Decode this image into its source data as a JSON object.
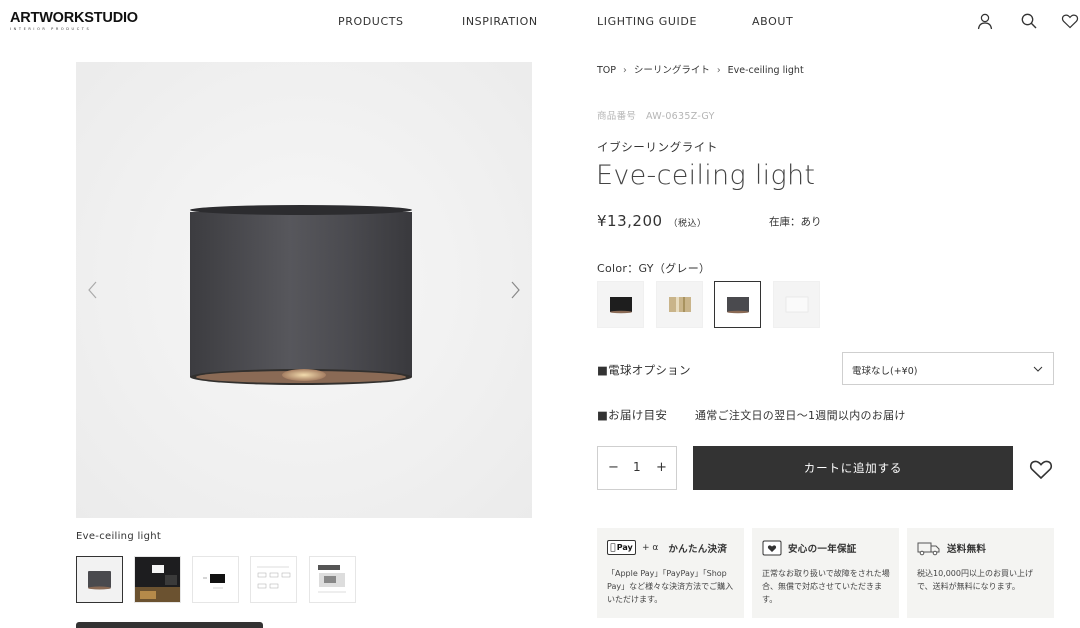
{
  "header": {
    "logo_main": "ARTWORKSTUDIO",
    "logo_sub": "INTERIOR PRODUCTS",
    "nav": [
      "PRODUCTS",
      "INSPIRATION",
      "LIGHTING GUIDE",
      "ABOUT"
    ],
    "icons": [
      "user-icon",
      "search-icon",
      "heart-icon"
    ]
  },
  "gallery": {
    "caption": "Eve-ceiling light",
    "thumbnails": [
      "product-gray",
      "room-photo",
      "dimension-diagram",
      "spec-sheet",
      "install-guide"
    ],
    "active_thumbnail": 0
  },
  "breadcrumb": [
    "TOP",
    "シーリングライト",
    "Eve-ceiling light"
  ],
  "product": {
    "sku": "商品番号　AW-0635Z-GY",
    "jp_name": "イブシーリングライト",
    "title": "Eve-ceiling light",
    "price": "¥13,200",
    "tax_note": "（税込）",
    "stock": "在庫：あり",
    "color_label": "Color：GY（グレー）",
    "swatches": [
      {
        "name": "black",
        "color": "#1e1e1e"
      },
      {
        "name": "brass",
        "color": "#c9b48a"
      },
      {
        "name": "gray",
        "color": "#4a4a4e"
      },
      {
        "name": "white",
        "color": "#f7f7f7"
      }
    ],
    "active_swatch": 2,
    "bulb_option_label": "■電球オプション",
    "bulb_option_value": "電球なし(+¥0)",
    "delivery_label": "■お届け目安",
    "delivery_value": "通常ご注文日の翌日〜1週間以内のお届け",
    "quantity": "1",
    "qty_minus": "−",
    "qty_plus": "+",
    "add_to_cart": "カートに追加する"
  },
  "features": [
    {
      "badge": "Pay",
      "badge_suffix": "+ α",
      "title": "かんたん決済",
      "body": "「Apple Pay」「PayPay」「Shop Pay」など様々な決済方法でご購入いただけます。"
    },
    {
      "title": "安心の一年保証",
      "body": "正常なお取り扱いで故障をされた場合、無償で対応させていただきます。"
    },
    {
      "title": "送料無料",
      "body": "税込10,000円以上のお買い上げで、送料が無料になります。"
    }
  ]
}
